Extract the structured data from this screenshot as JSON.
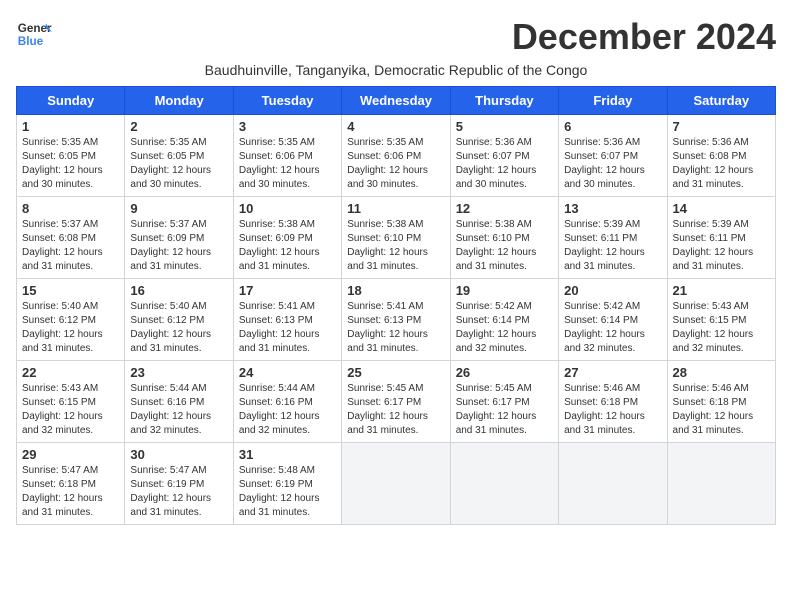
{
  "header": {
    "logo_line1": "General",
    "logo_line2": "Blue",
    "month_year": "December 2024",
    "location": "Baudhuinville, Tanganyika, Democratic Republic of the Congo"
  },
  "days_of_week": [
    "Sunday",
    "Monday",
    "Tuesday",
    "Wednesday",
    "Thursday",
    "Friday",
    "Saturday"
  ],
  "weeks": [
    [
      {
        "day": 1,
        "sunrise": "5:35 AM",
        "sunset": "6:05 PM",
        "daylight": "12 hours and 30 minutes."
      },
      {
        "day": 2,
        "sunrise": "5:35 AM",
        "sunset": "6:05 PM",
        "daylight": "12 hours and 30 minutes."
      },
      {
        "day": 3,
        "sunrise": "5:35 AM",
        "sunset": "6:06 PM",
        "daylight": "12 hours and 30 minutes."
      },
      {
        "day": 4,
        "sunrise": "5:35 AM",
        "sunset": "6:06 PM",
        "daylight": "12 hours and 30 minutes."
      },
      {
        "day": 5,
        "sunrise": "5:36 AM",
        "sunset": "6:07 PM",
        "daylight": "12 hours and 30 minutes."
      },
      {
        "day": 6,
        "sunrise": "5:36 AM",
        "sunset": "6:07 PM",
        "daylight": "12 hours and 30 minutes."
      },
      {
        "day": 7,
        "sunrise": "5:36 AM",
        "sunset": "6:08 PM",
        "daylight": "12 hours and 31 minutes."
      }
    ],
    [
      {
        "day": 8,
        "sunrise": "5:37 AM",
        "sunset": "6:08 PM",
        "daylight": "12 hours and 31 minutes."
      },
      {
        "day": 9,
        "sunrise": "5:37 AM",
        "sunset": "6:09 PM",
        "daylight": "12 hours and 31 minutes."
      },
      {
        "day": 10,
        "sunrise": "5:38 AM",
        "sunset": "6:09 PM",
        "daylight": "12 hours and 31 minutes."
      },
      {
        "day": 11,
        "sunrise": "5:38 AM",
        "sunset": "6:10 PM",
        "daylight": "12 hours and 31 minutes."
      },
      {
        "day": 12,
        "sunrise": "5:38 AM",
        "sunset": "6:10 PM",
        "daylight": "12 hours and 31 minutes."
      },
      {
        "day": 13,
        "sunrise": "5:39 AM",
        "sunset": "6:11 PM",
        "daylight": "12 hours and 31 minutes."
      },
      {
        "day": 14,
        "sunrise": "5:39 AM",
        "sunset": "6:11 PM",
        "daylight": "12 hours and 31 minutes."
      }
    ],
    [
      {
        "day": 15,
        "sunrise": "5:40 AM",
        "sunset": "6:12 PM",
        "daylight": "12 hours and 31 minutes."
      },
      {
        "day": 16,
        "sunrise": "5:40 AM",
        "sunset": "6:12 PM",
        "daylight": "12 hours and 31 minutes."
      },
      {
        "day": 17,
        "sunrise": "5:41 AM",
        "sunset": "6:13 PM",
        "daylight": "12 hours and 31 minutes."
      },
      {
        "day": 18,
        "sunrise": "5:41 AM",
        "sunset": "6:13 PM",
        "daylight": "12 hours and 31 minutes."
      },
      {
        "day": 19,
        "sunrise": "5:42 AM",
        "sunset": "6:14 PM",
        "daylight": "12 hours and 32 minutes."
      },
      {
        "day": 20,
        "sunrise": "5:42 AM",
        "sunset": "6:14 PM",
        "daylight": "12 hours and 32 minutes."
      },
      {
        "day": 21,
        "sunrise": "5:43 AM",
        "sunset": "6:15 PM",
        "daylight": "12 hours and 32 minutes."
      }
    ],
    [
      {
        "day": 22,
        "sunrise": "5:43 AM",
        "sunset": "6:15 PM",
        "daylight": "12 hours and 32 minutes."
      },
      {
        "day": 23,
        "sunrise": "5:44 AM",
        "sunset": "6:16 PM",
        "daylight": "12 hours and 32 minutes."
      },
      {
        "day": 24,
        "sunrise": "5:44 AM",
        "sunset": "6:16 PM",
        "daylight": "12 hours and 32 minutes."
      },
      {
        "day": 25,
        "sunrise": "5:45 AM",
        "sunset": "6:17 PM",
        "daylight": "12 hours and 31 minutes."
      },
      {
        "day": 26,
        "sunrise": "5:45 AM",
        "sunset": "6:17 PM",
        "daylight": "12 hours and 31 minutes."
      },
      {
        "day": 27,
        "sunrise": "5:46 AM",
        "sunset": "6:18 PM",
        "daylight": "12 hours and 31 minutes."
      },
      {
        "day": 28,
        "sunrise": "5:46 AM",
        "sunset": "6:18 PM",
        "daylight": "12 hours and 31 minutes."
      }
    ],
    [
      {
        "day": 29,
        "sunrise": "5:47 AM",
        "sunset": "6:18 PM",
        "daylight": "12 hours and 31 minutes."
      },
      {
        "day": 30,
        "sunrise": "5:47 AM",
        "sunset": "6:19 PM",
        "daylight": "12 hours and 31 minutes."
      },
      {
        "day": 31,
        "sunrise": "5:48 AM",
        "sunset": "6:19 PM",
        "daylight": "12 hours and 31 minutes."
      },
      null,
      null,
      null,
      null
    ]
  ]
}
